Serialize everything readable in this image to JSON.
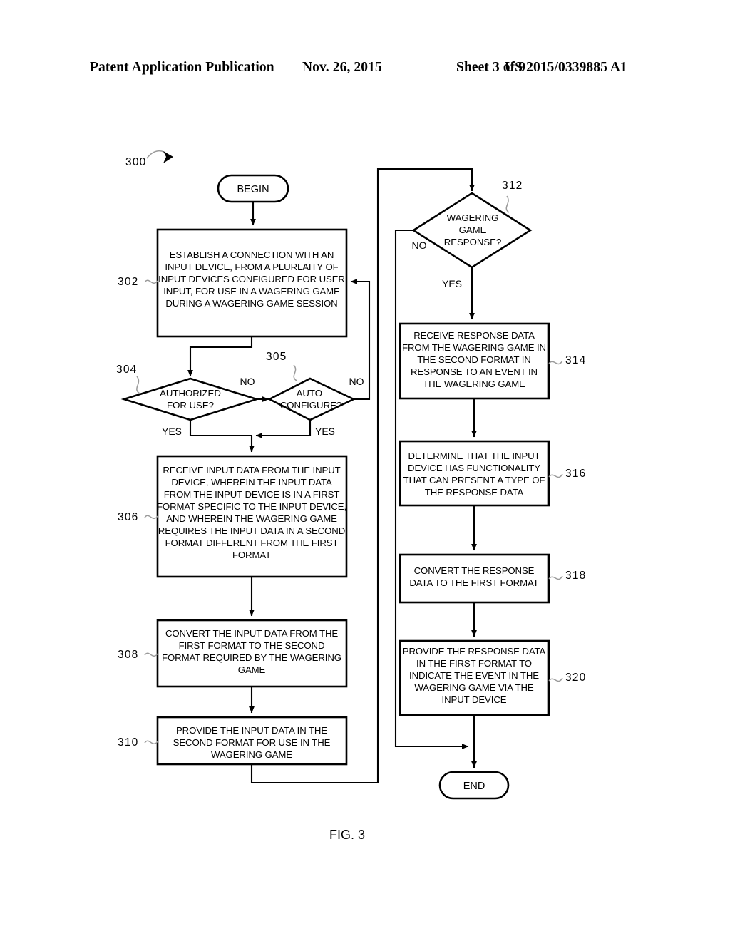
{
  "header": {
    "publication": "Patent Application Publication",
    "date": "Nov. 26, 2015",
    "sheet": "Sheet 3 of 9",
    "document_number": "US 2015/0339885 A1"
  },
  "figure": {
    "caption": "FIG. 3",
    "diagram_ref": "300",
    "terminators": {
      "begin": "BEGIN",
      "end": "END"
    },
    "branch_labels": {
      "yes": "YES",
      "no": "NO"
    },
    "nodes": [
      {
        "ref": "302",
        "type": "process",
        "lines": [
          "ESTABLISH A CONNECTION WITH AN",
          "INPUT DEVICE, FROM A PLURLAITY OF",
          "INPUT DEVICES CONFIGURED FOR USER",
          "INPUT, FOR USE IN A WAGERING GAME",
          "DURING A WAGERING GAME SESSION"
        ]
      },
      {
        "ref": "304",
        "type": "decision",
        "lines": [
          "AUTHORIZED",
          "FOR USE?"
        ]
      },
      {
        "ref": "305",
        "type": "decision",
        "lines": [
          "AUTO-",
          "CONFIGURE?"
        ]
      },
      {
        "ref": "306",
        "type": "process",
        "lines": [
          "RECEIVE INPUT DATA FROM THE INPUT",
          "DEVICE, WHEREIN THE INPUT DATA",
          "FROM THE INPUT DEVICE IS IN A FIRST",
          "FORMAT SPECIFIC TO THE INPUT DEVICE,",
          "AND WHEREIN THE WAGERING GAME",
          "REQUIRES THE INPUT DATA IN A SECOND",
          "FORMAT DIFFERENT FROM THE FIRST",
          "FORMAT"
        ]
      },
      {
        "ref": "308",
        "type": "process",
        "lines": [
          "CONVERT THE INPUT DATA FROM THE",
          "FIRST FORMAT TO THE SECOND",
          "FORMAT REQUIRED BY THE WAGERING",
          "GAME"
        ]
      },
      {
        "ref": "310",
        "type": "process",
        "lines": [
          "PROVIDE THE INPUT DATA IN THE",
          "SECOND FORMAT FOR USE IN THE",
          "WAGERING GAME"
        ]
      },
      {
        "ref": "312",
        "type": "decision",
        "lines": [
          "WAGERING",
          "GAME",
          "RESPONSE?"
        ]
      },
      {
        "ref": "314",
        "type": "process",
        "lines": [
          "RECEIVE RESPONSE DATA",
          "FROM THE WAGERING GAME IN",
          "THE SECOND FORMAT IN",
          "RESPONSE TO AN EVENT IN",
          "THE WAGERING GAME"
        ]
      },
      {
        "ref": "316",
        "type": "process",
        "lines": [
          "DETERMINE THAT THE INPUT",
          "DEVICE HAS FUNCTIONALITY",
          "THAT CAN PRESENT A TYPE OF",
          "THE RESPONSE DATA"
        ]
      },
      {
        "ref": "318",
        "type": "process",
        "lines": [
          "CONVERT THE RESPONSE",
          "DATA TO THE FIRST FORMAT"
        ]
      },
      {
        "ref": "320",
        "type": "process",
        "lines": [
          "PROVIDE THE RESPONSE DATA",
          "IN THE FIRST FORMAT TO",
          "INDICATE THE EVENT IN THE",
          "WAGERING GAME VIA THE",
          "INPUT DEVICE"
        ]
      }
    ]
  }
}
